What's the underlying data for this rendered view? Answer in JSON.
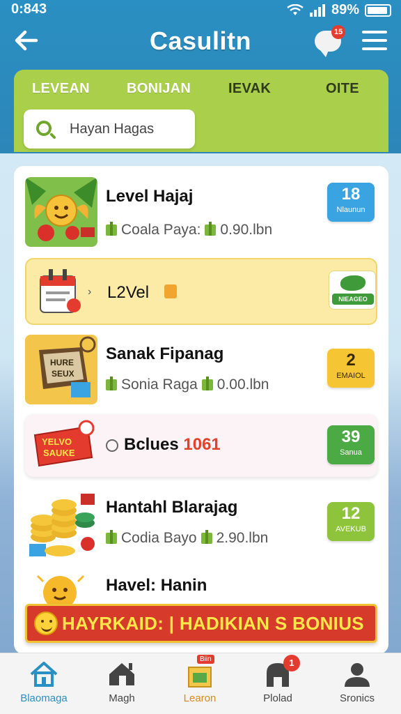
{
  "status_bar": {
    "time": "0:843",
    "battery": "89%"
  },
  "app_bar": {
    "title": "Casulitn",
    "chat_badge": "15"
  },
  "filter_tabs": [
    "LEVEAN",
    "BONIJAN",
    "IEVAK",
    "OITE"
  ],
  "search": {
    "value": "Hayan Hagas",
    "placeholder": ""
  },
  "items": [
    {
      "title": "Level Hajaj",
      "sub_a": "Coala Paya:",
      "sub_b": "0.90.lbn",
      "badge_num": "18",
      "badge_label": "Nlaunun"
    },
    {
      "title": "L2Vel",
      "tag_label": "NIEAGEO"
    },
    {
      "title": "Sanak Fipanag",
      "sub_a": "Sonia Raga",
      "sub_b": "0.00.lbn",
      "badge_num": "2",
      "badge_label": "EMAIOL",
      "thumb_text_a": "HURE",
      "thumb_text_b": "SEUX"
    },
    {
      "title": "Bclues",
      "title_highlight": "1061",
      "badge_num": "39",
      "badge_label": "Sanua",
      "thumb_text_a": "YELVO",
      "thumb_text_b": "SAUKE"
    },
    {
      "title": "Hantahl Blarajag",
      "sub_a": "Codia Bayo",
      "sub_b": "2.90.lbn",
      "badge_num": "12",
      "badge_label": "AVEKUB"
    },
    {
      "title": "Havel: Hanin"
    }
  ],
  "promo_banner": "HAYRKAID: | HADIKIAN S BONIUS",
  "bottom_nav": [
    {
      "label": "Blaomaga",
      "icon": "home-icon"
    },
    {
      "label": "Magh",
      "icon": "house-icon"
    },
    {
      "label": "Learon",
      "icon": "store-icon",
      "tag": "Biin"
    },
    {
      "label": "Plolad",
      "icon": "arch-icon",
      "badge": "1"
    },
    {
      "label": "Sronics",
      "icon": "profile-icon"
    }
  ],
  "colors": {
    "header_blue": "#2a8fc2",
    "filter_green": "#a9cf4b",
    "promo_red": "#d63a2a",
    "promo_text": "#ffe74a"
  }
}
